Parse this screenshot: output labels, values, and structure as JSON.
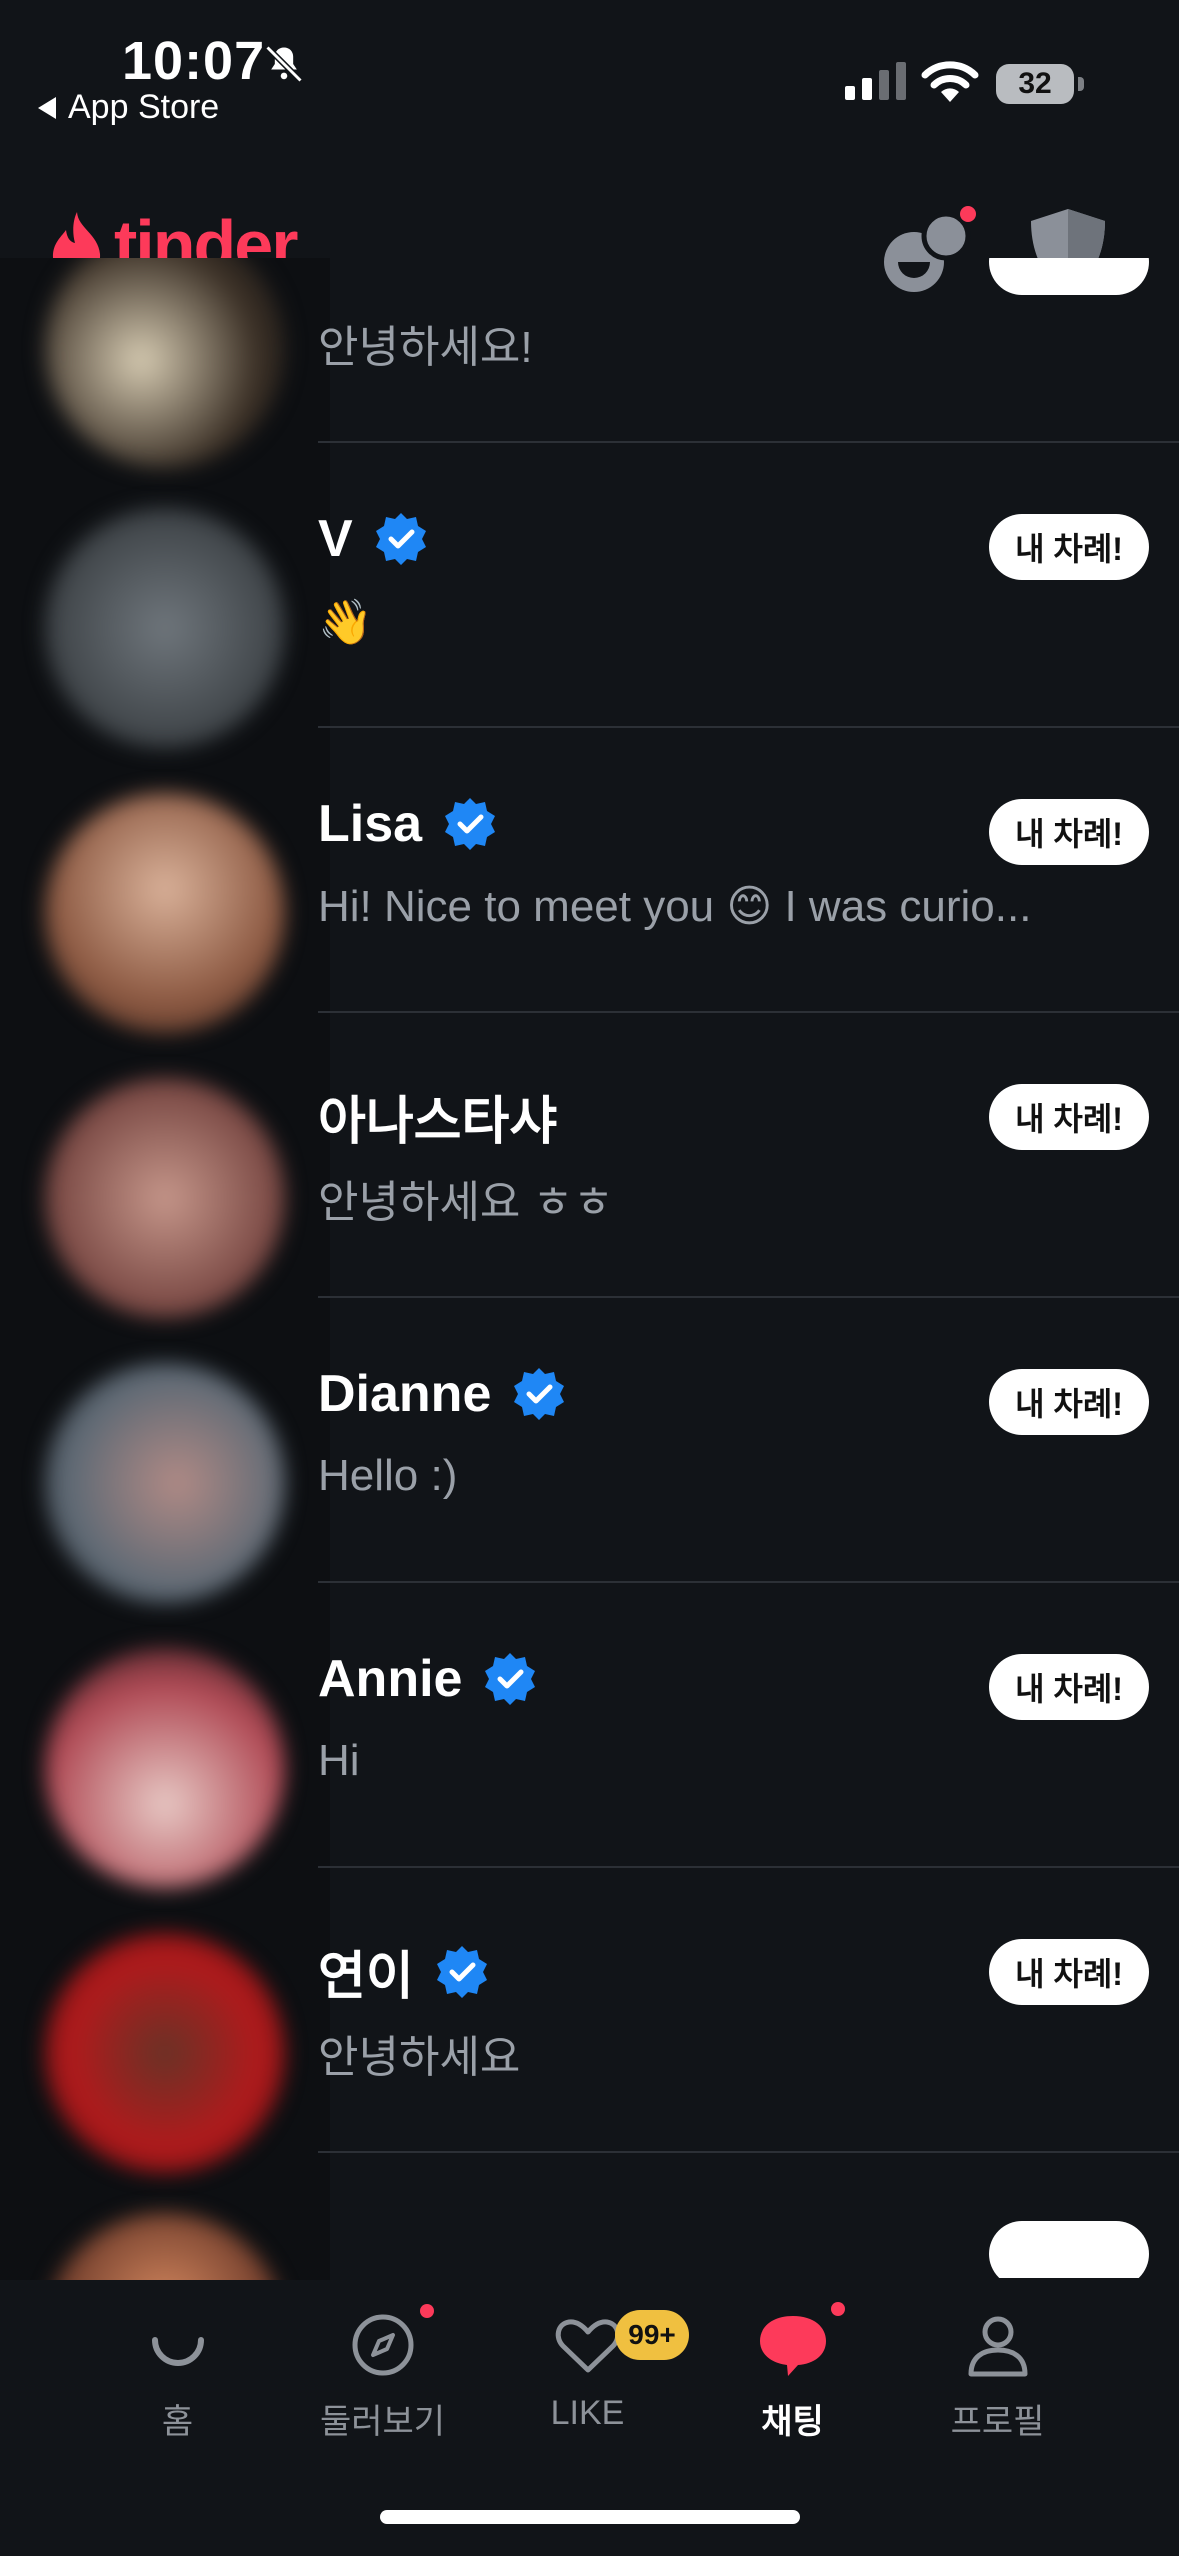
{
  "status_bar": {
    "time": "10:07",
    "back_label": "App Store",
    "battery": "32"
  },
  "header": {
    "logo": "tinder",
    "brand_color": "#fd3a5a"
  },
  "chats": [
    {
      "name": "",
      "message": "안녕하세요!",
      "verified": true,
      "turn_label": ""
    },
    {
      "name": "V",
      "message": "👋",
      "verified": true,
      "turn_label": "내 차례!"
    },
    {
      "name": "Lisa",
      "message": "Hi! Nice to meet you 😊 I was curio...",
      "verified": true,
      "turn_label": "내 차례!"
    },
    {
      "name": "아나스타샤",
      "message": "안녕하세요 ㅎㅎ",
      "verified": false,
      "turn_label": "내 차례!"
    },
    {
      "name": "Dianne",
      "message": "Hello :)",
      "verified": true,
      "turn_label": "내 차례!"
    },
    {
      "name": "Annie",
      "message": "Hi",
      "verified": true,
      "turn_label": "내 차례!"
    },
    {
      "name": "연이",
      "message": "안녕하세요",
      "verified": true,
      "turn_label": "내 차례!"
    }
  ],
  "bottom_nav": {
    "items": [
      {
        "label": "홈",
        "icon": "home-icon"
      },
      {
        "label": "둘러보기",
        "icon": "compass-icon"
      },
      {
        "label": "LIKE",
        "icon": "heart-icon"
      },
      {
        "label": "채팅",
        "icon": "chat-icon"
      },
      {
        "label": "프로필",
        "icon": "profile-icon"
      }
    ],
    "like_badge": "99+"
  }
}
